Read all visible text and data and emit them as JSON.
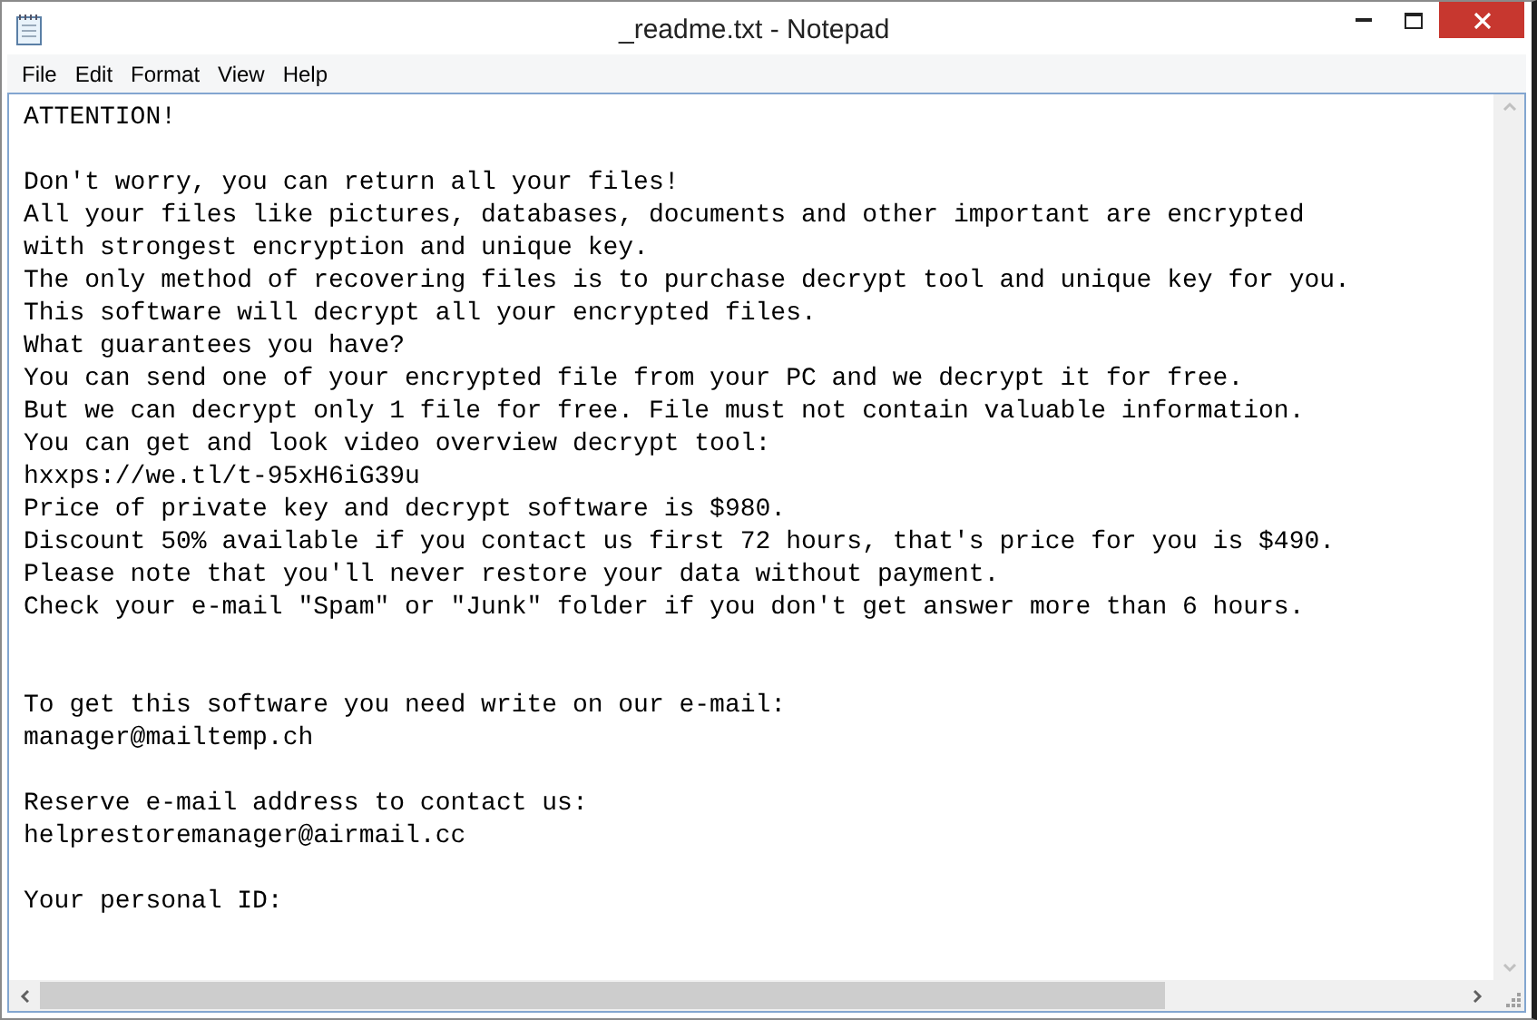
{
  "window": {
    "title": "_readme.txt - Notepad"
  },
  "menu": [
    "File",
    "Edit",
    "Format",
    "View",
    "Help"
  ],
  "document": {
    "text": "ATTENTION!\n\nDon't worry, you can return all your files!\nAll your files like pictures, databases, documents and other important are encrypted\nwith strongest encryption and unique key.\nThe only method of recovering files is to purchase decrypt tool and unique key for you.\nThis software will decrypt all your encrypted files.\nWhat guarantees you have?\nYou can send one of your encrypted file from your PC and we decrypt it for free.\nBut we can decrypt only 1 file for free. File must not contain valuable information.\nYou can get and look video overview decrypt tool:\nhxxps://we.tl/t-95xH6iG39u\nPrice of private key and decrypt software is $980.\nDiscount 50% available if you contact us first 72 hours, that's price for you is $490.\nPlease note that you'll never restore your data without payment.\nCheck your e-mail \"Spam\" or \"Junk\" folder if you don't get answer more than 6 hours.\n\n\nTo get this software you need write on our e-mail:\nmanager@mailtemp.ch\n\nReserve e-mail address to contact us:\nhelprestoremanager@airmail.cc\n\nYour personal ID:"
  }
}
